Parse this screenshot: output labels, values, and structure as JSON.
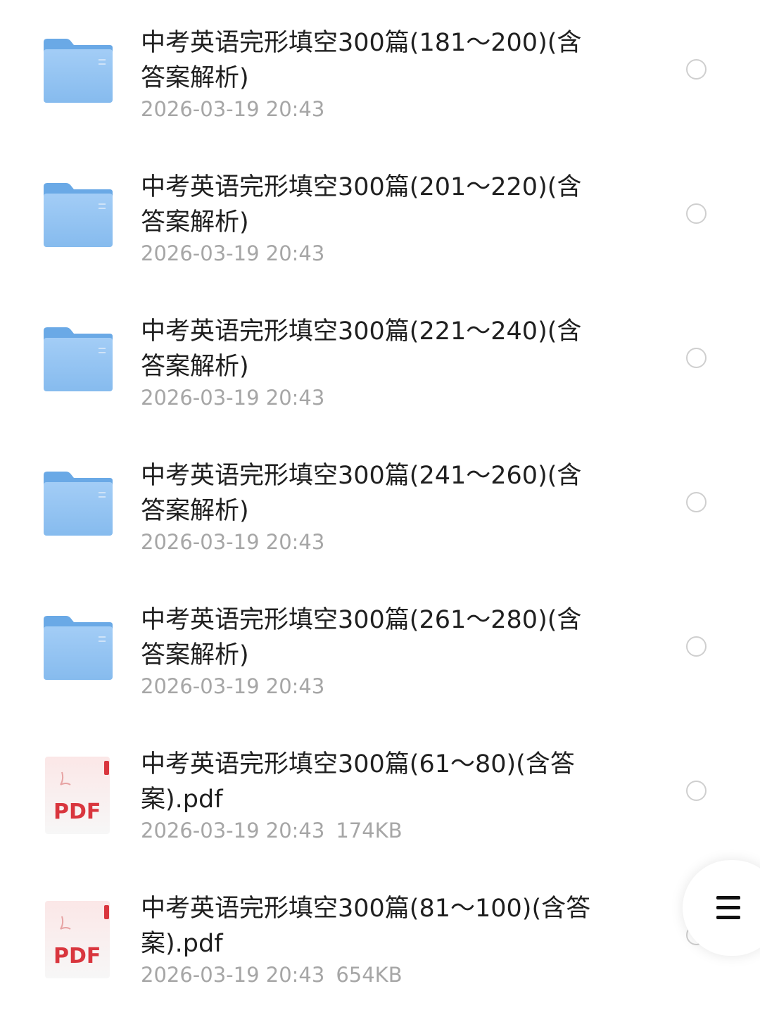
{
  "files": [
    {
      "type": "folder",
      "name": "中考英语完形填空300篇(181～200)(含答案解析)",
      "date": "2026-03-19 20:43",
      "size": ""
    },
    {
      "type": "folder",
      "name": "中考英语完形填空300篇(201～220)(含答案解析)",
      "date": "2026-03-19 20:43",
      "size": ""
    },
    {
      "type": "folder",
      "name": "中考英语完形填空300篇(221～240)(含答案解析)",
      "date": "2026-03-19 20:43",
      "size": ""
    },
    {
      "type": "folder",
      "name": "中考英语完形填空300篇(241～260)(含答案解析)",
      "date": "2026-03-19 20:43",
      "size": ""
    },
    {
      "type": "folder",
      "name": "中考英语完形填空300篇(261～280)(含答案解析)",
      "date": "2026-03-19 20:43",
      "size": ""
    },
    {
      "type": "pdf",
      "name": "中考英语完形填空300篇(61～80)(含答案).pdf",
      "date": "2026-03-19 20:43",
      "size": "174KB"
    },
    {
      "type": "pdf",
      "name": "中考英语完形填空300篇(81～100)(含答案).pdf",
      "date": "2026-03-19 20:43",
      "size": "654KB"
    }
  ],
  "pdf_icon_label": "PDF",
  "icons": {
    "folder": "folder-icon",
    "pdf": "pdf-file-icon",
    "select": "radio-circle",
    "menu": "hamburger-icon"
  },
  "colors": {
    "folder_blue": "#8fc0f2",
    "pdf_red": "#d9363e",
    "title_text": "#1f1f1f",
    "meta_text": "#a6a6a6"
  }
}
